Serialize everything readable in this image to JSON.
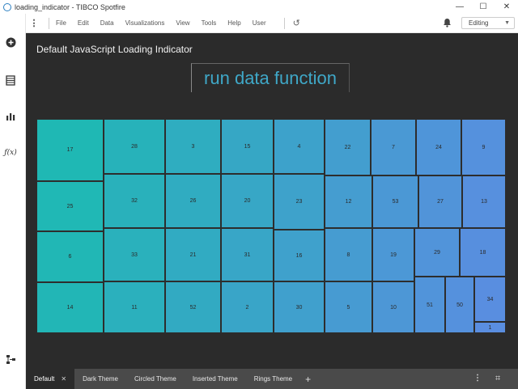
{
  "window": {
    "title": "loading_indicator - TIBCO Spotfire",
    "minimize": "—",
    "maximize": "☐",
    "close": "✕"
  },
  "menu": {
    "items": [
      "File",
      "Edit",
      "Data",
      "Visualizations",
      "View",
      "Tools",
      "Help",
      "User"
    ],
    "mode": "Editing"
  },
  "visualization": {
    "title": "Default JavaScript Loading Indicator",
    "button": "run data function"
  },
  "chart_data": {
    "type": "treemap",
    "title": "Default JavaScript Loading Indicator",
    "labels": [
      "17",
      "28",
      "3",
      "15",
      "4",
      "22",
      "7",
      "24",
      "9",
      "25",
      "32",
      "26",
      "20",
      "23",
      "12",
      "53",
      "27",
      "13",
      "6",
      "33",
      "21",
      "31",
      "16",
      "8",
      "19",
      "29",
      "18",
      "14",
      "11",
      "52",
      "2",
      "30",
      "5",
      "10",
      "51",
      "50",
      "34",
      "1"
    ]
  },
  "tabs": [
    {
      "label": "Default",
      "active": true
    },
    {
      "label": "Dark Theme",
      "active": false
    },
    {
      "label": "Circled Theme",
      "active": false
    },
    {
      "label": "Inserted Theme",
      "active": false
    },
    {
      "label": "Rings Theme",
      "active": false
    }
  ],
  "tab_add": "+",
  "colors": {
    "canvas": "#2b2b2b",
    "accent": "#3fa8c8",
    "teal": "#1abcb0",
    "blue": "#5a8ee0"
  }
}
